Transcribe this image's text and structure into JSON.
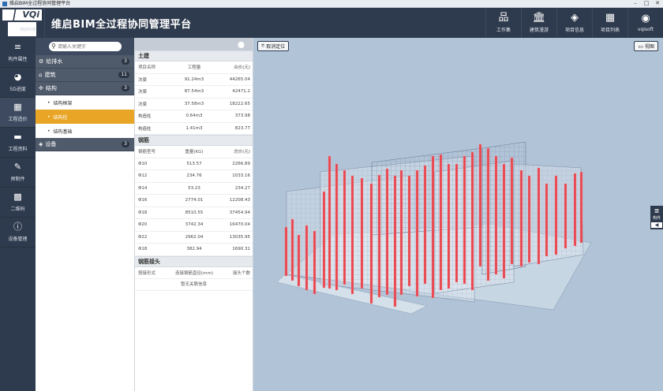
{
  "titlebar": {
    "text": "维启BIM全过程协同管理平台"
  },
  "brand": {
    "logo_text": "VQi",
    "logo_sub": "维启科技",
    "title": "维启BIM全过程协同管理平台"
  },
  "topnav": [
    {
      "label": "工作集",
      "icon": "sitemap-icon",
      "glyph": "品"
    },
    {
      "label": "建筑漫游",
      "icon": "bank-icon",
      "glyph": "🏛"
    },
    {
      "label": "项目信息",
      "icon": "layers-icon",
      "glyph": "◈"
    },
    {
      "label": "项目列表",
      "icon": "grid-icon",
      "glyph": "▦"
    },
    {
      "label": "vqisoft",
      "icon": "user-icon",
      "glyph": "◉"
    }
  ],
  "leftnav": [
    {
      "label": "构件属性",
      "icon": "attributes-icon",
      "glyph": "≡"
    },
    {
      "label": "5D进度",
      "icon": "pie-icon",
      "glyph": "◕"
    },
    {
      "label": "工程造价",
      "icon": "calculator-icon",
      "glyph": "▦"
    },
    {
      "label": "工程资料",
      "icon": "folder-icon",
      "glyph": "▬"
    },
    {
      "label": "预制件",
      "icon": "edit-icon",
      "glyph": "✎"
    },
    {
      "label": "二维码",
      "icon": "qrcode-icon",
      "glyph": "▩"
    },
    {
      "label": "设备管理",
      "icon": "info-icon",
      "glyph": "ⓘ"
    }
  ],
  "search": {
    "placeholder": "请输入关键字"
  },
  "tree": {
    "cat1": {
      "label": "给排水",
      "count": "3"
    },
    "cat2": {
      "label": "建筑",
      "count": "11"
    },
    "cat3": {
      "label": "结构",
      "count": "3"
    },
    "subs": [
      "结构框架",
      "结构柱",
      "结构基础"
    ],
    "cat4": {
      "label": "设备",
      "count": "3"
    }
  },
  "data": {
    "sec1": "土建",
    "h1": [
      "项目名称",
      "工程量",
      "合价(元)"
    ],
    "rows1": [
      [
        "次梁",
        "91.24m3",
        "44265.04"
      ],
      [
        "次梁",
        "87.54m3",
        "42471.2"
      ],
      [
        "次梁",
        "37.58m3",
        "18222.65"
      ],
      [
        "构造柱",
        "0.64m3",
        "373.98"
      ],
      [
        "构造柱",
        "1.41m3",
        "823.77"
      ]
    ],
    "sec2": "钢筋",
    "h2": [
      "钢筋型号",
      "重量(KG)",
      "总价(元)"
    ],
    "rows2": [
      [
        "Φ10",
        "513.57",
        "2266.89"
      ],
      [
        "Φ12",
        "234.76",
        "1033.16"
      ],
      [
        "Φ14",
        "53.23",
        "234.27"
      ],
      [
        "Φ16",
        "2774.01",
        "12208.43"
      ],
      [
        "Φ18",
        "8510.55",
        "37454.94"
      ],
      [
        "Φ20",
        "3742.34",
        "16470.04"
      ],
      [
        "Φ22",
        "2962.04",
        "13035.95"
      ],
      [
        "Φ18",
        "382.94",
        "1690.31"
      ]
    ],
    "sec3": "钢筋接头",
    "h3": [
      "搭接形式",
      "连接钢筋直径(mm)",
      "接头个数"
    ],
    "nodata": "暂无关联信息"
  },
  "viewer": {
    "cancel_label": "取消定位",
    "view_label": "视图",
    "side_label": "构件",
    "side_arrow": "◀"
  },
  "colors": {
    "header": "#2e3a4d",
    "selected": "#e8a526",
    "column": "#e8434b",
    "viewport": "#b0c3d7"
  }
}
